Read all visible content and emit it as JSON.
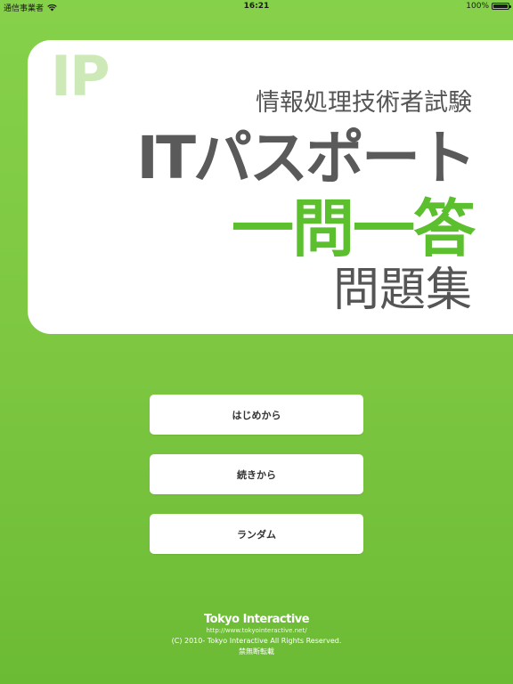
{
  "status_bar": {
    "carrier": "通信事業者",
    "time": "16:21",
    "battery": "100%",
    "battery_level": 1.0
  },
  "title_panel": {
    "logo_mark": "IP",
    "exam_label": "情報処理技術者試験",
    "main_title": "ITパスポート",
    "sub_title": "一問一答",
    "collection_label": "問題集"
  },
  "menu": {
    "start_label": "はじめから",
    "continue_label": "続きから",
    "random_label": "ランダム"
  },
  "footer": {
    "company": "Tokyo Interactive",
    "url": "http://www.tokyointeractive.net/",
    "copyright": "(C) 2010- Tokyo Interactive All Rights Reserved.",
    "notice": "禁無断転載"
  },
  "colors": {
    "background": "#7cc640",
    "accent_green": "#5bbf2e",
    "logo_tint": "#cde9b8",
    "title_gray": "#5a5a5a",
    "panel": "#ffffff"
  },
  "icons": [
    "wifi-icon",
    "battery-icon"
  ]
}
